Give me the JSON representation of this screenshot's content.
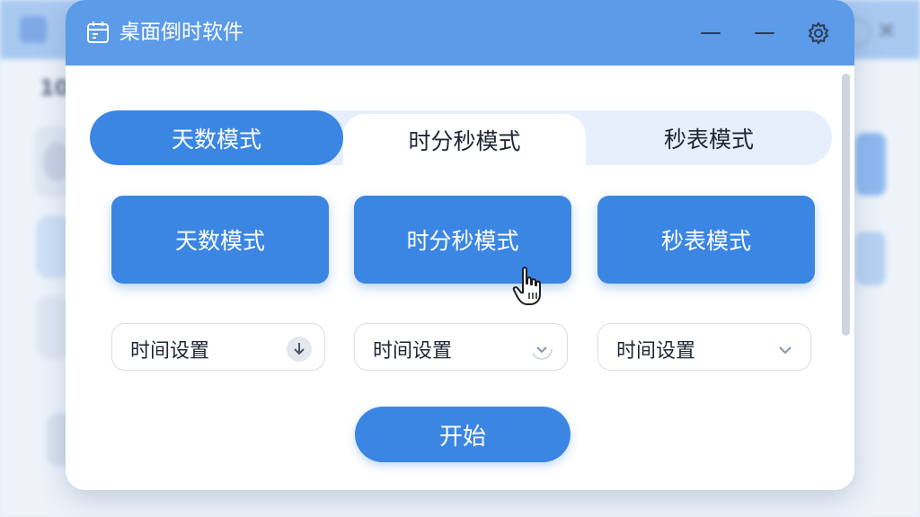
{
  "background": {
    "number_fragment": "10"
  },
  "window": {
    "title": "桌面倒时软件",
    "icons": {
      "app": "calendar-icon",
      "minimize": "minimize-icon",
      "settings": "gear-icon"
    }
  },
  "tabs": [
    {
      "label": "天数模式",
      "state": "active"
    },
    {
      "label": "时分秒模式",
      "state": "hover"
    },
    {
      "label": "秒表模式",
      "state": "inactive"
    }
  ],
  "mode_buttons": [
    {
      "label": "天数模式"
    },
    {
      "label": "时分秒模式"
    },
    {
      "label": "秒表模式"
    }
  ],
  "time_settings": [
    {
      "label": "时间设置",
      "icon": "download-circle-icon"
    },
    {
      "label": "时间设置",
      "icon": "chevron-down-icon"
    },
    {
      "label": "时间设置",
      "icon": "chevron-down-icon"
    }
  ],
  "start_button": {
    "label": "开始"
  },
  "colors": {
    "accent": "#3c86e3",
    "titlebar": "#5b9be8",
    "tab_track": "#e6effb"
  }
}
